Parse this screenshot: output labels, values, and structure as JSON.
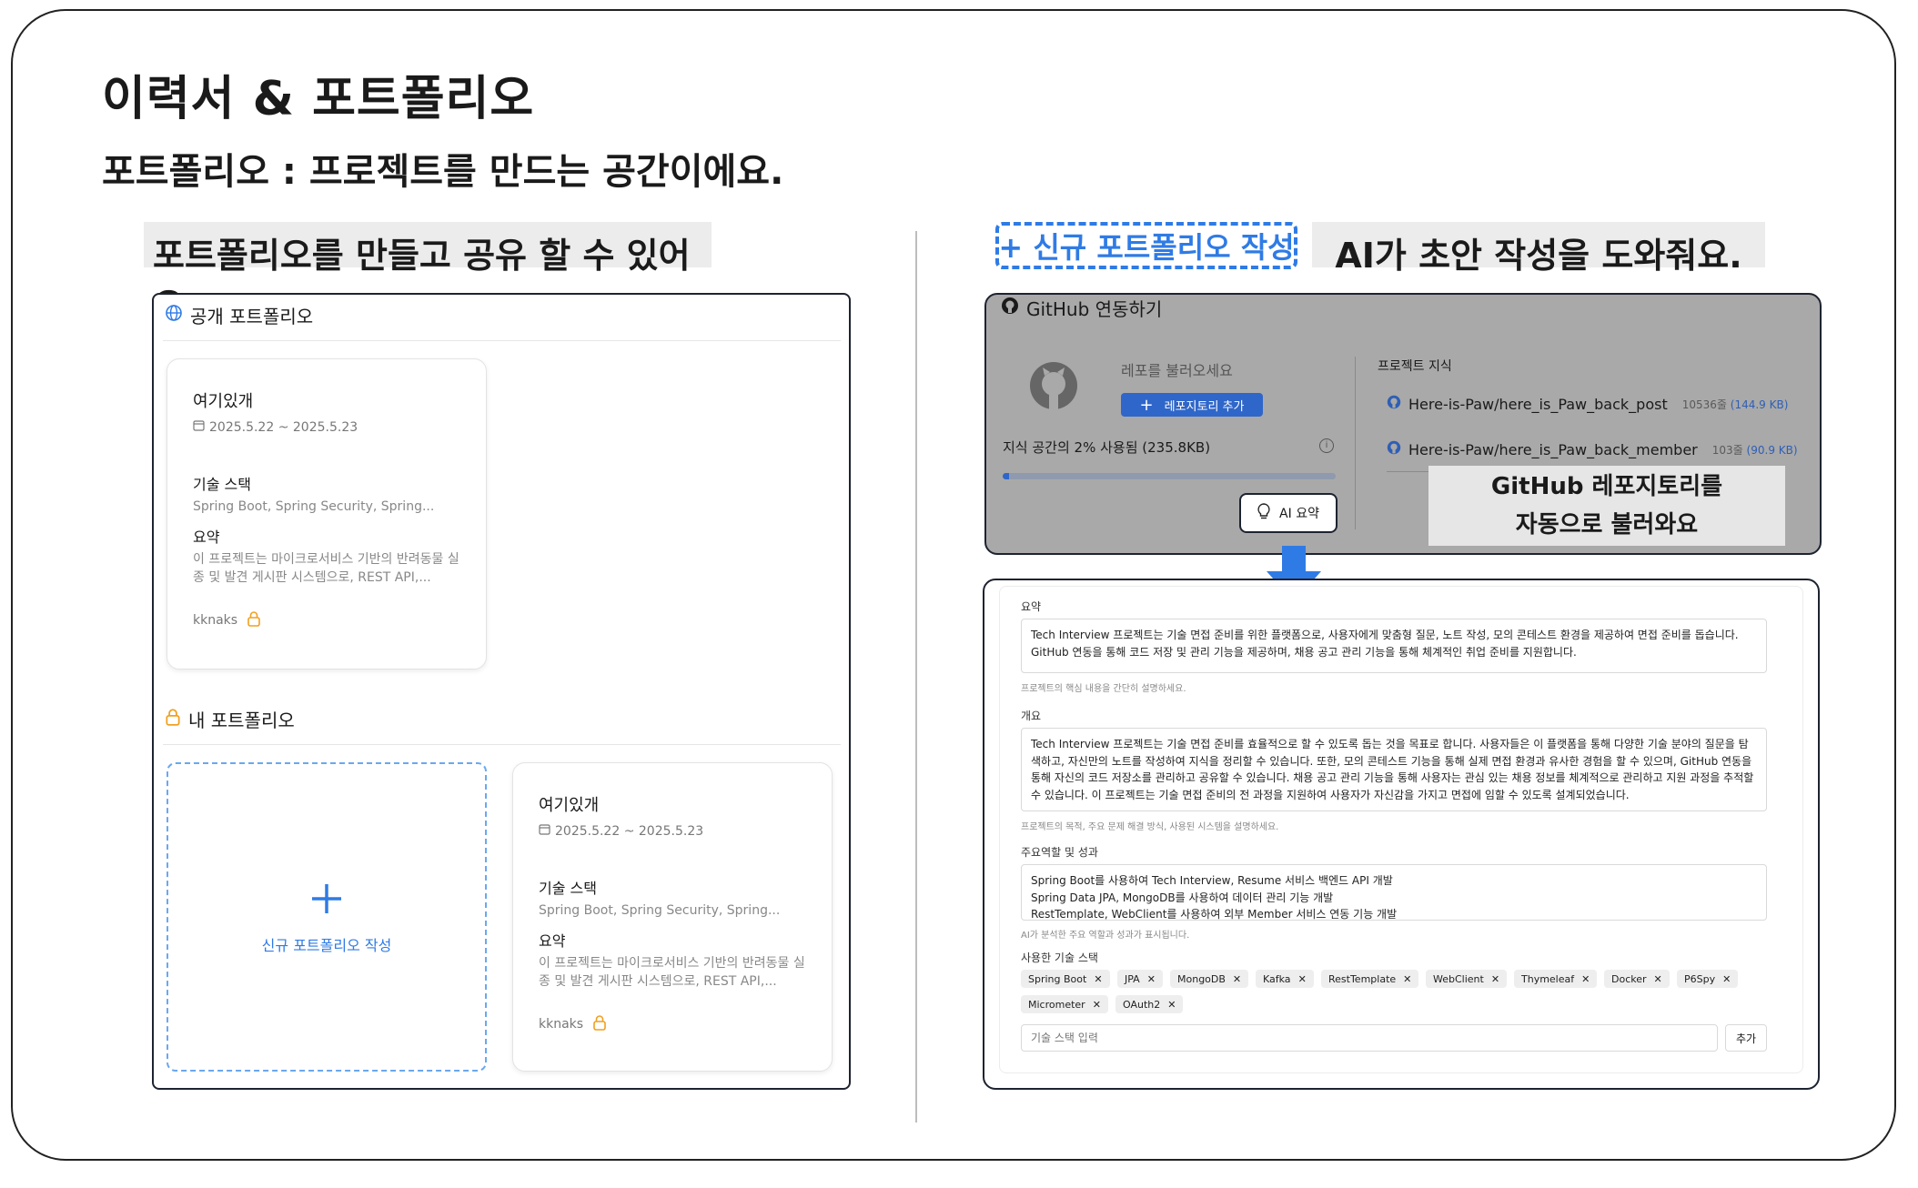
{
  "header": {
    "title": "이력서 & 포트폴리오",
    "subtitle": "포트폴리오 : 프로젝트를 만드는 공간이에요."
  },
  "left": {
    "caption": "포트폴리오를 만들고 공유 할 수 있어요.",
    "public_section": "공개 포트폴리오",
    "my_section": "내 포트폴리오",
    "new_portfolio": "신규 포트폴리오 작성",
    "card": {
      "title": "여기있개",
      "date": "2025.5.22 ~ 2025.5.23",
      "stack_label": "기술 스택",
      "stack_value": "Spring Boot, Spring Security, Spring...",
      "summary_label": "요약",
      "summary_line1": "이 프로젝트는 마이크로서비스 기반의 반려동물 실",
      "summary_line2": "종 및 발견 게시판 시스템으로, REST API,...",
      "author": "kknaks"
    }
  },
  "right": {
    "new_button": "+ 신규 포트폴리오 작성",
    "caption": "AI가 초안 작성을 도와줘요.",
    "github": {
      "title": "GitHub 연동하기",
      "load_repo": "레포를 불러오세요",
      "add_repo": "레포지토리 추가",
      "usage": "지식 공간의 2% 사용됨 (235.8KB)",
      "usage_fraction": 0.02,
      "ai_summary": "AI 요약",
      "knowledge_title": "프로젝트 지식",
      "repos": [
        {
          "name": "Here-is-Paw/here_is_Paw_back_post",
          "lines": "10536줄",
          "size": "(144.9 KB)"
        },
        {
          "name": "Here-is-Paw/here_is_Paw_back_member",
          "lines": "103줄",
          "size": "(90.9 KB)"
        }
      ],
      "callout_line1": "GitHub 레포지토리를",
      "callout_line2": "자동으로 불러와요"
    },
    "form": {
      "summary_label": "요약",
      "summary_text": "Tech Interview 프로젝트는 기술 면접 준비를 위한 플랫폼으로, 사용자에게 맞춤형 질문, 노트 작성, 모의 콘테스트 환경을 제공하여 면접 준비를 돕습니다. GitHub 연동을 통해 코드 저장 및 관리 기능을 제공하며, 채용 공고 관리 기능을 통해 체계적인 취업 준비를 지원합니다.",
      "summary_hint": "프로젝트의 핵심 내용을 간단히 설명하세요.",
      "overview_label": "개요",
      "overview_text": "Tech Interview 프로젝트는 기술 면접 준비를 효율적으로 할 수 있도록 돕는 것을 목표로 합니다. 사용자들은 이 플랫폼을 통해 다양한 기술 분야의 질문을 탐색하고, 자신만의 노트를 작성하여 지식을 정리할 수 있습니다. 또한, 모의 콘테스트 기능을 통해 실제 면접 환경과 유사한 경험을 할 수 있으며, GitHub 연동을 통해 자신의 코드 저장소를 관리하고 공유할 수 있습니다. 채용 공고 관리 기능을 통해 사용자는 관심 있는 채용 정보를 체계적으로 관리하고 지원 과정을 추적할 수 있습니다. 이 프로젝트는 기술 면접 준비의 전 과정을 지원하여 사용자가 자신감을 가지고 면접에 임할 수 있도록 설계되었습니다.",
      "overview_hint": "프로젝트의 목적, 주요 문제 해결 방식, 사용된 시스템을 설명하세요.",
      "role_label": "주요역할 및 성과",
      "role_line1": "Spring Boot를 사용하여 Tech Interview, Resume 서비스 백엔드 API 개발",
      "role_line2": "Spring Data JPA, MongoDB를 사용하여 데이터 관리 기능 개발",
      "role_line3": "RestTemplate, WebClient를 사용하여 외부 Member 서비스 연동 기능 개발",
      "role_hint": "AI가 분석한 주요 역할과 성과가 표시됩니다.",
      "stack_label": "사용한 기술 스택",
      "chips": [
        "Spring Boot",
        "JPA",
        "MongoDB",
        "Kafka",
        "RestTemplate",
        "WebClient",
        "Thymeleaf",
        "Docker",
        "P6Spy",
        "Micrometer",
        "OAuth2"
      ],
      "stack_placeholder": "기술 스택 입력",
      "add_button": "추가"
    }
  },
  "colors": {
    "accent": "#2f7be5",
    "lock": "#f0a020",
    "gray_panel": "#a9a9a9"
  }
}
